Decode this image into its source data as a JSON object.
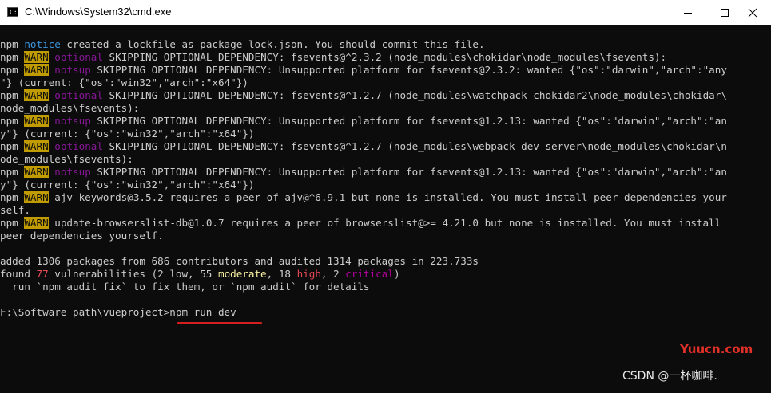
{
  "window": {
    "title": "C:\\Windows\\System32\\cmd.exe",
    "icon": "cmd-icon",
    "icon_glyph": "C:\\",
    "buttons": [
      "minimize-icon",
      "maximize-icon",
      "close-icon"
    ]
  },
  "colors": {
    "background": "#0c0c0c",
    "foreground": "#cccccc",
    "notice": "#3a96dd",
    "warn_bg": "#c19c00",
    "optional": "#881798",
    "notsup": "#881798",
    "high": "#e74856",
    "moderate": "#f9f1a5",
    "critical": "#b4009e",
    "underline": "#d41f1f",
    "watermark_red": "#e03028"
  },
  "console": {
    "lines": [
      [
        {
          "t": "npm "
        },
        {
          "t": "notice",
          "c": "blue"
        },
        {
          "t": " created a lockfile as package-lock.json. You should commit this file."
        }
      ],
      [
        {
          "t": "npm "
        },
        {
          "t": "WARN",
          "c": "warn"
        },
        {
          "t": " "
        },
        {
          "t": "optional",
          "c": "magenta"
        },
        {
          "t": " SKIPPING OPTIONAL DEPENDENCY: fsevents@^2.3.2 (node_modules\\chokidar\\node_modules\\fsevents):"
        }
      ],
      [
        {
          "t": "npm "
        },
        {
          "t": "WARN",
          "c": "warn"
        },
        {
          "t": " "
        },
        {
          "t": "notsup",
          "c": "magenta"
        },
        {
          "t": " SKIPPING OPTIONAL DEPENDENCY: Unsupported platform for fsevents@2.3.2: wanted {\"os\":\"darwin\",\"arch\":\"any"
        }
      ],
      [
        {
          "t": "\"} (current: {\"os\":\"win32\",\"arch\":\"x64\"})"
        }
      ],
      [
        {
          "t": "npm "
        },
        {
          "t": "WARN",
          "c": "warn"
        },
        {
          "t": " "
        },
        {
          "t": "optional",
          "c": "magenta"
        },
        {
          "t": " SKIPPING OPTIONAL DEPENDENCY: fsevents@^1.2.7 (node_modules\\watchpack-chokidar2\\node_modules\\chokidar\\"
        }
      ],
      [
        {
          "t": "node_modules\\fsevents):"
        }
      ],
      [
        {
          "t": "npm "
        },
        {
          "t": "WARN",
          "c": "warn"
        },
        {
          "t": " "
        },
        {
          "t": "notsup",
          "c": "magenta"
        },
        {
          "t": " SKIPPING OPTIONAL DEPENDENCY: Unsupported platform for fsevents@1.2.13: wanted {\"os\":\"darwin\",\"arch\":\"an"
        }
      ],
      [
        {
          "t": "y\"} (current: {\"os\":\"win32\",\"arch\":\"x64\"})"
        }
      ],
      [
        {
          "t": "npm "
        },
        {
          "t": "WARN",
          "c": "warn"
        },
        {
          "t": " "
        },
        {
          "t": "optional",
          "c": "magenta"
        },
        {
          "t": " SKIPPING OPTIONAL DEPENDENCY: fsevents@^1.2.7 (node_modules\\webpack-dev-server\\node_modules\\chokidar\\n"
        }
      ],
      [
        {
          "t": "ode_modules\\fsevents):"
        }
      ],
      [
        {
          "t": "npm "
        },
        {
          "t": "WARN",
          "c": "warn"
        },
        {
          "t": " "
        },
        {
          "t": "notsup",
          "c": "magenta"
        },
        {
          "t": " SKIPPING OPTIONAL DEPENDENCY: Unsupported platform for fsevents@1.2.13: wanted {\"os\":\"darwin\",\"arch\":\"an"
        }
      ],
      [
        {
          "t": "y\"} (current: {\"os\":\"win32\",\"arch\":\"x64\"})"
        }
      ],
      [
        {
          "t": "npm "
        },
        {
          "t": "WARN",
          "c": "warn"
        },
        {
          "t": " ajv-keywords@3.5.2 requires a peer of ajv@^6.9.1 but none is installed. You must install peer dependencies your"
        }
      ],
      [
        {
          "t": "self."
        }
      ],
      [
        {
          "t": "npm "
        },
        {
          "t": "WARN",
          "c": "warn"
        },
        {
          "t": " update-browserslist-db@1.0.7 requires a peer of browserslist@>= 4.21.0 but none is installed. You must install"
        }
      ],
      [
        {
          "t": "peer dependencies yourself."
        }
      ],
      [
        {
          "t": ""
        }
      ],
      [
        {
          "t": "added 1306 packages from 686 contributors and audited 1314 packages in 223.733s"
        }
      ],
      [
        {
          "t": "found "
        },
        {
          "t": "77",
          "c": "red"
        },
        {
          "t": " vulnerabilities (2 low, 55 "
        },
        {
          "t": "moderate",
          "c": "yellow"
        },
        {
          "t": ", 18 "
        },
        {
          "t": "high",
          "c": "red"
        },
        {
          "t": ", 2 "
        },
        {
          "t": "critical",
          "c": "purple"
        },
        {
          "t": ")"
        }
      ],
      [
        {
          "t": "  run `npm audit fix` to fix them, or `npm audit` for details"
        }
      ],
      [
        {
          "t": ""
        }
      ],
      [
        {
          "t": "F:\\Software path\\vueproject>npm run dev"
        }
      ]
    ]
  },
  "watermarks": {
    "yuucn": "Yuucn.com",
    "csdn": "CSDN @一杯咖啡."
  }
}
